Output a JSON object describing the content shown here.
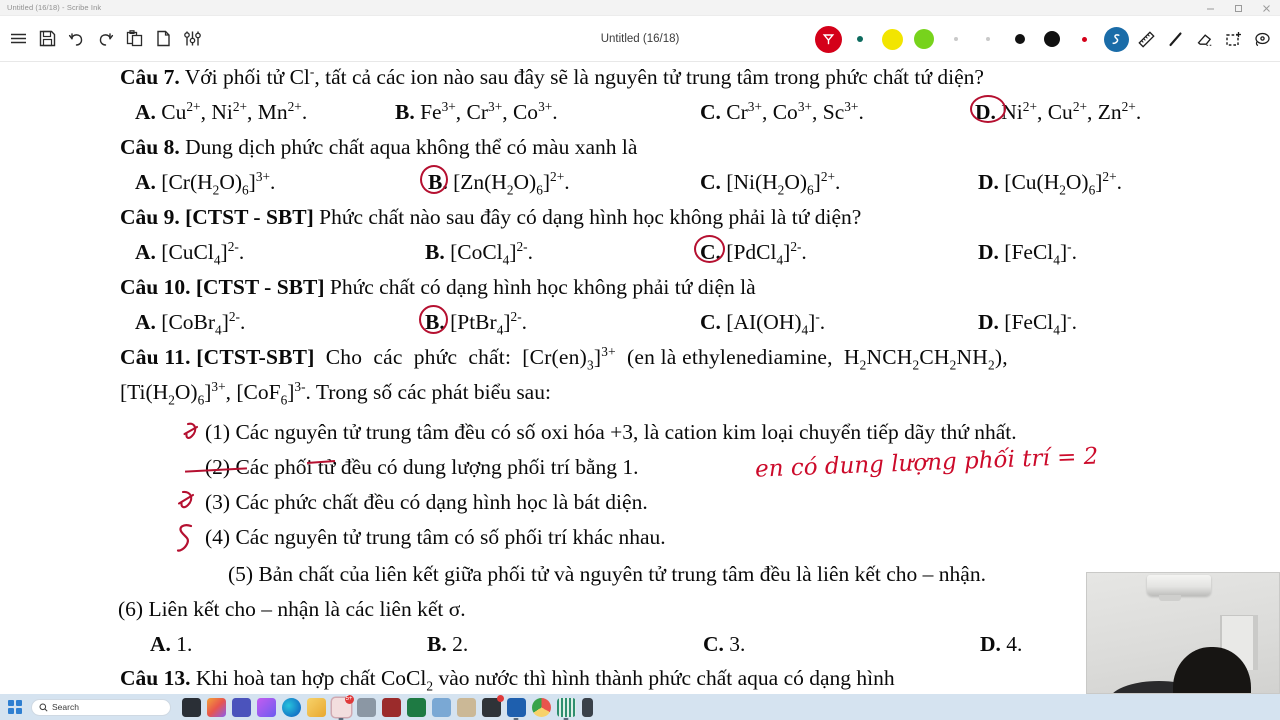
{
  "window": {
    "title_bar_text": "Untitled (16/18) - Scribe Ink",
    "doc_title": "Untitled (16/18)",
    "controls": {
      "minimize": "minimize-icon",
      "maximize": "maximize-icon",
      "close": "close-icon"
    }
  },
  "toolbar": {
    "left_icons": [
      {
        "name": "menu-icon",
        "label": "Menu"
      },
      {
        "name": "save-icon",
        "label": "Save"
      },
      {
        "name": "undo-icon",
        "label": "Undo"
      },
      {
        "name": "redo-icon",
        "label": "Redo"
      },
      {
        "name": "paste-icon",
        "label": "Paste"
      },
      {
        "name": "new-page-icon",
        "label": "New page"
      },
      {
        "name": "settings-sliders-icon",
        "label": "Settings"
      }
    ],
    "pens": [
      {
        "name": "pen-red-highlighter",
        "color": "#d40019",
        "selected": true,
        "size": 27
      },
      {
        "name": "pen-teal-small",
        "color": "#0d6b5e",
        "selected": false,
        "size": 6
      },
      {
        "name": "pen-yellow",
        "color": "#f2e500",
        "selected": false,
        "size": 21
      },
      {
        "name": "pen-green",
        "color": "#77d31c",
        "selected": false,
        "size": 20
      },
      {
        "name": "pen-gray-tiny-1",
        "color": "#c9c9c9",
        "selected": false,
        "size": 4
      },
      {
        "name": "pen-gray-tiny-2",
        "color": "#c9c9c9",
        "selected": false,
        "size": 4
      },
      {
        "name": "pen-black-medium",
        "color": "#111111",
        "selected": false,
        "size": 10
      },
      {
        "name": "pen-black-large",
        "color": "#111111",
        "selected": false,
        "size": 16
      },
      {
        "name": "pen-red-tiny",
        "color": "#d40019",
        "selected": false,
        "size": 5
      }
    ],
    "tools": [
      {
        "name": "scribble-tool-icon",
        "label": "Scribble",
        "selected": true,
        "color": "#1a6ca8"
      },
      {
        "name": "ruler-icon",
        "label": "Ruler",
        "selected": false
      },
      {
        "name": "pen-line-icon",
        "label": "Pen",
        "selected": false
      },
      {
        "name": "eraser-icon",
        "label": "Eraser",
        "selected": false
      },
      {
        "name": "select-rectangle-icon",
        "label": "Select",
        "selected": false
      },
      {
        "name": "lasso-icon",
        "label": "Lasso",
        "selected": false
      }
    ]
  },
  "document": {
    "lines": [
      {
        "id": "cau7-q",
        "text": "Câu 7. Với phối tử Cl-, tất cả các ion nào sau đây sẽ là nguyên tử trung tâm trong phức chất tứ diện?"
      },
      {
        "id": "cau7-a",
        "text": "A. Cu2+, Ni2+, Mn2+."
      },
      {
        "id": "cau7-b",
        "text": "B. Fe3+, Cr3+, Co3+."
      },
      {
        "id": "cau7-c",
        "text": "C. Cr3+, Co3+, Sc3+."
      },
      {
        "id": "cau7-d",
        "text": "D. Ni2+, Cu2+, Zn2+."
      },
      {
        "id": "cau8-q",
        "text": "Câu 8. Dung dịch phức chất aqua không thể có màu xanh là"
      },
      {
        "id": "cau8-a",
        "text": "A. [Cr(H2O)6]3+."
      },
      {
        "id": "cau8-b",
        "text": "B. [Zn(H2O)6]2+."
      },
      {
        "id": "cau8-c",
        "text": "C. [Ni(H2O)6]2+."
      },
      {
        "id": "cau8-d",
        "text": "D. [Cu(H2O)6]2+."
      },
      {
        "id": "cau9-q",
        "text": "Câu 9. [CTST - SBT] Phức chất nào sau đây có dạng hình học không phải là tứ diện?"
      },
      {
        "id": "cau9-a",
        "text": "A. [CuCl4]2-."
      },
      {
        "id": "cau9-b",
        "text": "B. [CoCl4]2-."
      },
      {
        "id": "cau9-c",
        "text": "C. [PdCl4]2-."
      },
      {
        "id": "cau9-d",
        "text": "D. [FeCl4]-."
      },
      {
        "id": "cau10-q",
        "text": "Câu 10. [CTST - SBT] Phức chất có dạng hình học không phải tứ diện là"
      },
      {
        "id": "cau10-a",
        "text": "A. [CoBr4]2-."
      },
      {
        "id": "cau10-b",
        "text": "B. [PtBr4]2-."
      },
      {
        "id": "cau10-c",
        "text": "C. [AI(OH)4]-."
      },
      {
        "id": "cau10-d",
        "text": "D. [FeCl4]-."
      },
      {
        "id": "cau11-q1",
        "text": "Câu 11. [CTST-SBT] Cho các phức chất: [Cr(en)3]3+ (en là ethylenediamine, H2NCH2CH2NH2),"
      },
      {
        "id": "cau11-q2",
        "text": "[Ti(H2O)6]3+, [CoF6]3-. Trong số các phát biểu sau:"
      },
      {
        "id": "st1",
        "text": "(1) Các nguyên tử trung tâm đều có số oxi hóa +3, là cation kim loại chuyển tiếp dãy thứ nhất."
      },
      {
        "id": "st2",
        "text": "(2) Các phối tử đều có dung lượng phối trí bằng 1."
      },
      {
        "id": "st3",
        "text": "(3) Các phức chất đều có dạng hình học là bát diện."
      },
      {
        "id": "st4",
        "text": "(4) Các nguyên tử trung tâm có số phối trí khác nhau."
      },
      {
        "id": "st5",
        "text": "(5) Bản chất của liên kết giữa phối tử và nguyên tử trung tâm đều là liên kết cho – nhận."
      },
      {
        "id": "st6",
        "text": "(6) Liên kết cho – nhận là các liên kết σ."
      },
      {
        "id": "cau11-a",
        "text": "A. 1."
      },
      {
        "id": "cau11-b",
        "text": "B. 2."
      },
      {
        "id": "cau11-c",
        "text": "C. 3."
      },
      {
        "id": "cau11-d",
        "text": "D. 4."
      },
      {
        "id": "cau13-q",
        "text": "Câu 13. Khi hoà tan hợp chất CoCl2 vào nước thì hình thành phức chất aqua có dạng hình"
      }
    ],
    "annotations": {
      "handwritten_note": "en có dung lượng phối trí = 2",
      "ink_color": "#cc0a2a",
      "circled_answers": [
        "Câu 7: D",
        "Câu 8: B",
        "Câu 9: C",
        "Câu 10: B"
      ],
      "struck_statements": [
        "(1)",
        "(2)",
        "(3)"
      ],
      "marked_statements": [
        "(4)"
      ]
    }
  },
  "webcam": {
    "name": "webcam-overlay",
    "scene": "room with wall-mounted air conditioner, door, and top of a person's head"
  },
  "taskbar": {
    "start": "windows-start-icon",
    "search": {
      "placeholder": "Search",
      "icon": "search-icon"
    },
    "apps": [
      {
        "name": "taskbar-app-file-explorer-dark",
        "color": "#2a2f36",
        "badge": ""
      },
      {
        "name": "taskbar-app-copilot",
        "color": "#e8554d",
        "badge": ""
      },
      {
        "name": "taskbar-app-teams",
        "color": "#4b53bc",
        "badge": ""
      },
      {
        "name": "taskbar-app-photos",
        "color": "#9b5cf0",
        "badge": ""
      },
      {
        "name": "taskbar-app-edge",
        "color": "#1476c6",
        "badge": ""
      },
      {
        "name": "taskbar-app-file-explorer",
        "color": "#f4bf46",
        "badge": ""
      },
      {
        "name": "taskbar-app-messenger",
        "color": "#e4eef8",
        "badge": "5+"
      },
      {
        "name": "taskbar-app-grid",
        "color": "#6f7f90",
        "badge": ""
      },
      {
        "name": "taskbar-app-onenote",
        "color": "#9b2b2b",
        "badge": ""
      },
      {
        "name": "taskbar-app-excel",
        "color": "#1e7a43",
        "badge": ""
      },
      {
        "name": "taskbar-app-snip",
        "color": "#5a8ac0",
        "badge": ""
      },
      {
        "name": "taskbar-app-photoshop",
        "color": "#c9b07a",
        "badge": ""
      },
      {
        "name": "taskbar-app-media",
        "color": "#d42a2a",
        "badge": ""
      },
      {
        "name": "taskbar-app-word",
        "color": "#1e5fae",
        "badge": ""
      },
      {
        "name": "taskbar-app-chrome",
        "color": "#37a34a",
        "badge": ""
      },
      {
        "name": "taskbar-app-qr",
        "color": "#2f8f6f",
        "badge": ""
      },
      {
        "name": "taskbar-app-phone-link",
        "color": "#3a4149",
        "badge": ""
      }
    ]
  }
}
